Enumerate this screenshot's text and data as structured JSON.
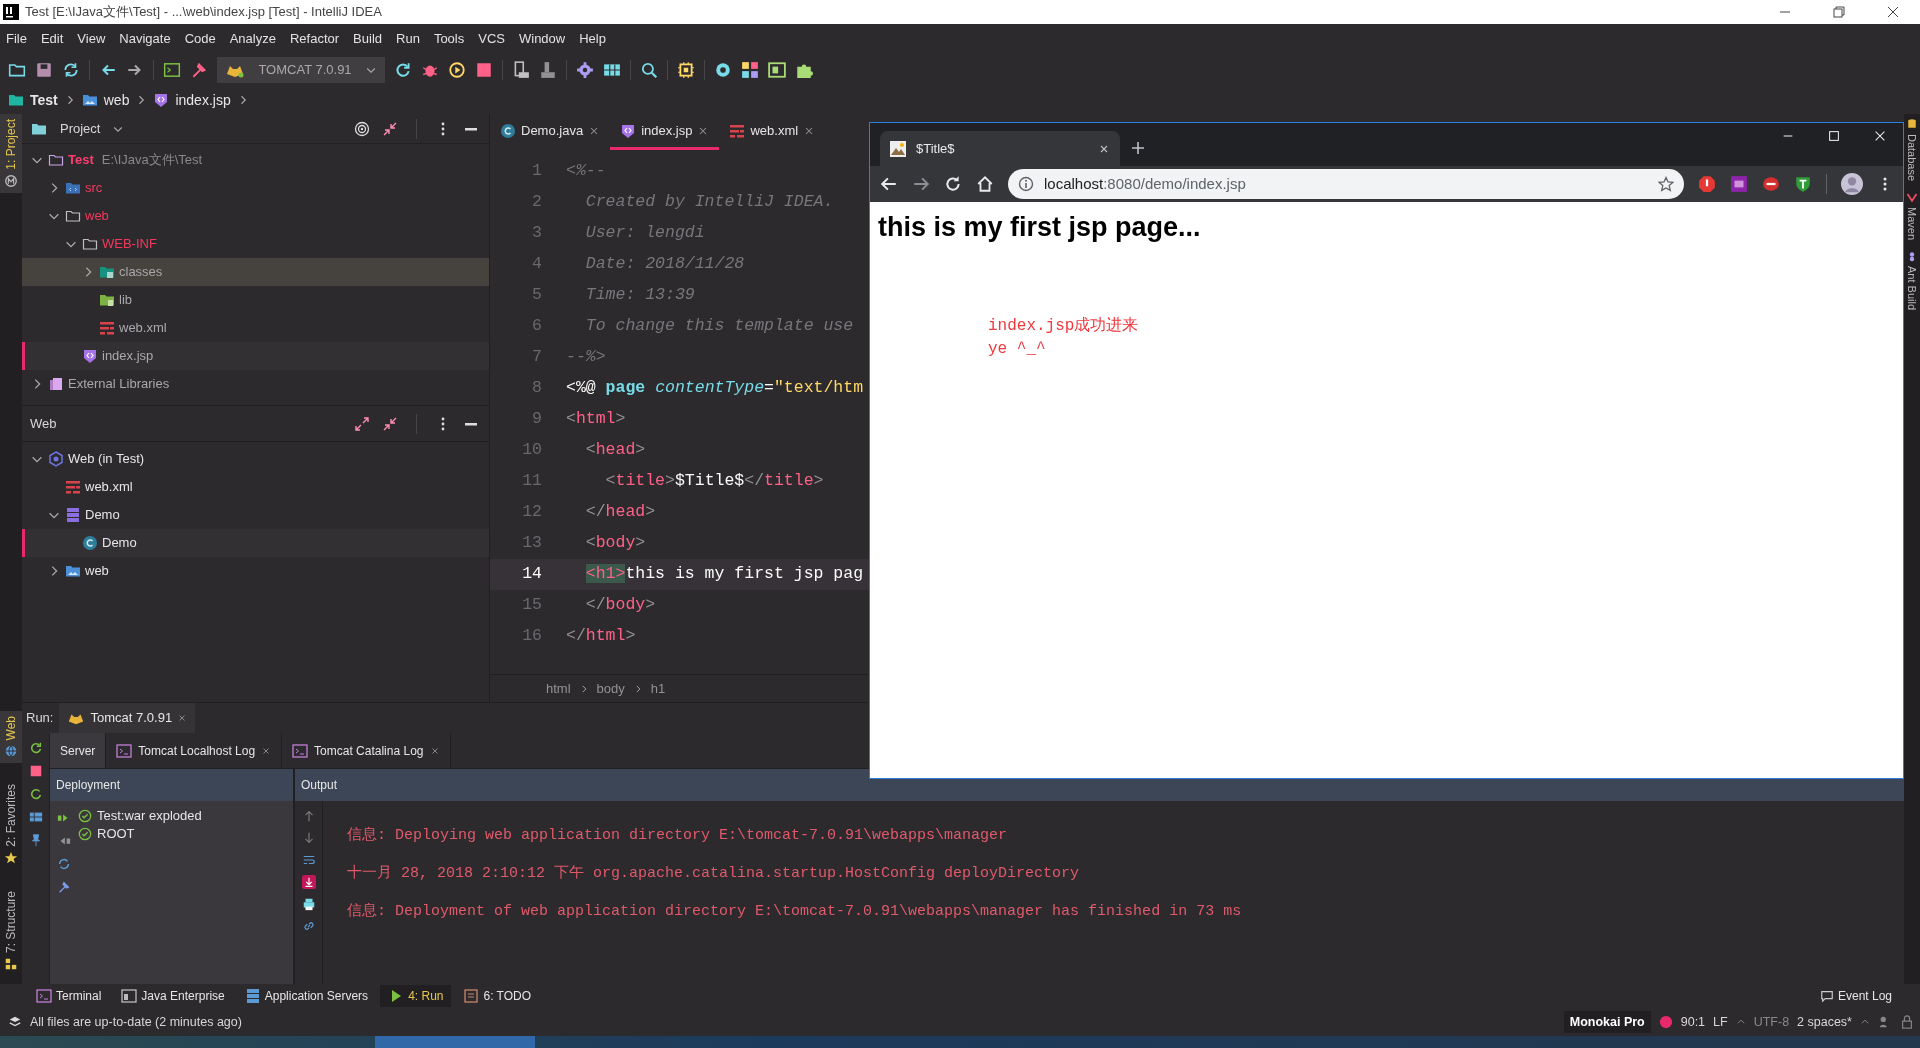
{
  "window": {
    "title": "Test [E:\\IJava文件\\Test] - ...\\web\\index.jsp [Test] - IntelliJ IDEA"
  },
  "menu": [
    "File",
    "Edit",
    "View",
    "Navigate",
    "Code",
    "Analyze",
    "Refactor",
    "Build",
    "Run",
    "Tools",
    "VCS",
    "Window",
    "Help"
  ],
  "toolbar": {
    "run_config": "TOMCAT 7.0.91"
  },
  "breadcrumb": [
    {
      "label": "Test",
      "kind": "project"
    },
    {
      "label": "web",
      "kind": "webroot"
    },
    {
      "label": "index.jsp",
      "kind": "jsp"
    }
  ],
  "left_stripe": {
    "top": [
      {
        "label": "1: Project",
        "kind": "project",
        "selected": true
      }
    ],
    "bottom": [
      {
        "label": "Web",
        "kind": "web",
        "selected": true
      },
      {
        "label": "2: Favorites",
        "kind": "favorites",
        "selected": false
      },
      {
        "label": "7: Structure",
        "kind": "structure",
        "selected": false
      }
    ]
  },
  "project_panel": {
    "title": "Project",
    "tree": [
      {
        "label": "Test",
        "path": "E:\\IJava文件\\Test",
        "kind": "module",
        "color": "#ff3d6e",
        "expanded": true,
        "selected": false,
        "current": false,
        "children": [
          {
            "label": "src",
            "kind": "src",
            "color": "#f23a5e",
            "expanded": false,
            "selected": false,
            "current": false
          },
          {
            "label": "web",
            "kind": "folder",
            "color": "#f23a5e",
            "expanded": true,
            "selected": false,
            "current": false,
            "children": [
              {
                "label": "WEB-INF",
                "kind": "folder",
                "color": "#f23a5e",
                "expanded": true,
                "selected": false,
                "current": false,
                "children": [
                  {
                    "label": "classes",
                    "kind": "classes",
                    "color": "#a9a8aa",
                    "expanded": false,
                    "selected": true,
                    "current": false
                  },
                  {
                    "label": "lib",
                    "kind": "lib",
                    "color": "#a9a8aa",
                    "selected": false,
                    "current": false
                  },
                  {
                    "label": "web.xml",
                    "kind": "xml",
                    "color": "#a9a8aa",
                    "selected": false,
                    "current": false
                  }
                ]
              },
              {
                "label": "index.jsp",
                "kind": "jsp",
                "color": "#a9a8aa",
                "selected": false,
                "current": true
              }
            ]
          }
        ]
      },
      {
        "label": "External Libraries",
        "kind": "libraries",
        "color": "#a9a8aa",
        "expanded": false,
        "selected": false,
        "current": false
      }
    ]
  },
  "web_panel": {
    "title": "Web",
    "tree": [
      {
        "label": "Web (in Test)",
        "kind": "facet",
        "color": "#e6e6e6",
        "expanded": true,
        "selected": false,
        "current": false,
        "children": [
          {
            "label": "web.xml",
            "kind": "xml",
            "color": "#e6e6e6",
            "selected": false,
            "current": false
          },
          {
            "label": "Demo",
            "kind": "artifact",
            "color": "#e6e6e6",
            "expanded": true,
            "selected": false,
            "current": false,
            "children": [
              {
                "label": "Demo",
                "kind": "class",
                "color": "#e6e6e6",
                "selected": false,
                "current": true
              }
            ]
          },
          {
            "label": "web",
            "kind": "webroot",
            "color": "#e6e6e6",
            "expanded": false,
            "selected": false,
            "current": false
          }
        ]
      }
    ]
  },
  "editor": {
    "tabs": [
      {
        "label": "Demo.java",
        "kind": "class",
        "selected": false
      },
      {
        "label": "index.jsp",
        "kind": "jsp",
        "selected": true
      },
      {
        "label": "web.xml",
        "kind": "xml",
        "selected": false
      }
    ],
    "lines": [
      {
        "n": "1",
        "current": false,
        "tokens": [
          {
            "kind": "comment",
            "t": "<%--"
          }
        ]
      },
      {
        "n": "2",
        "current": false,
        "tokens": [
          {
            "kind": "comment",
            "t": "  Created by IntelliJ IDEA."
          }
        ]
      },
      {
        "n": "3",
        "current": false,
        "tokens": [
          {
            "kind": "comment",
            "t": "  User: lengdi"
          }
        ]
      },
      {
        "n": "4",
        "current": false,
        "tokens": [
          {
            "kind": "comment",
            "t": "  Date: 2018/11/28"
          }
        ]
      },
      {
        "n": "5",
        "current": false,
        "tokens": [
          {
            "kind": "comment",
            "t": "  Time: 13:39"
          }
        ]
      },
      {
        "n": "6",
        "current": false,
        "tokens": [
          {
            "kind": "comment",
            "t": "  To change this template use"
          }
        ]
      },
      {
        "n": "7",
        "current": false,
        "tokens": [
          {
            "kind": "comment",
            "t": "--%>"
          }
        ]
      },
      {
        "n": "8",
        "current": false,
        "tokens": [
          {
            "kind": "plain",
            "t": "<%@ "
          },
          {
            "kind": "keyword",
            "t": "page "
          },
          {
            "kind": "attribute",
            "t": "contentType"
          },
          {
            "kind": "plain",
            "t": "="
          },
          {
            "kind": "string",
            "t": "\"text/htm"
          }
        ]
      },
      {
        "n": "9",
        "current": false,
        "tokens": [
          {
            "kind": "bracket",
            "t": "<"
          },
          {
            "kind": "tag",
            "t": "html"
          },
          {
            "kind": "bracket",
            "t": ">"
          }
        ]
      },
      {
        "n": "10",
        "current": false,
        "tokens": [
          {
            "kind": "bracket",
            "t": "  <"
          },
          {
            "kind": "tag",
            "t": "head"
          },
          {
            "kind": "bracket",
            "t": ">"
          }
        ]
      },
      {
        "n": "11",
        "current": false,
        "tokens": [
          {
            "kind": "bracket",
            "t": "    <"
          },
          {
            "kind": "tag",
            "t": "title"
          },
          {
            "kind": "bracket",
            "t": ">"
          },
          {
            "kind": "plain",
            "t": "$Title$"
          },
          {
            "kind": "bracket",
            "t": "</"
          },
          {
            "kind": "tag",
            "t": "title"
          },
          {
            "kind": "bracket",
            "t": ">"
          }
        ]
      },
      {
        "n": "12",
        "current": false,
        "tokens": [
          {
            "kind": "bracket",
            "t": "  </"
          },
          {
            "kind": "tag",
            "t": "head"
          },
          {
            "kind": "bracket",
            "t": ">"
          }
        ]
      },
      {
        "n": "13",
        "current": false,
        "tokens": [
          {
            "kind": "bracket",
            "t": "  <"
          },
          {
            "kind": "tag",
            "t": "body"
          },
          {
            "kind": "bracket",
            "t": ">"
          }
        ]
      },
      {
        "n": "14",
        "current": true,
        "tokens": [
          {
            "kind": "match",
            "t": "<h1>"
          },
          {
            "kind": "plain",
            "t": "this is my first jsp pag"
          }
        ]
      },
      {
        "n": "15",
        "current": false,
        "tokens": [
          {
            "kind": "bracket",
            "t": "  </"
          },
          {
            "kind": "tag",
            "t": "body"
          },
          {
            "kind": "bracket",
            "t": ">"
          }
        ]
      },
      {
        "n": "16",
        "current": false,
        "tokens": [
          {
            "kind": "bracket",
            "t": "</"
          },
          {
            "kind": "tag",
            "t": "html"
          },
          {
            "kind": "bracket",
            "t": ">"
          }
        ]
      }
    ],
    "crumbs": [
      "html",
      "body",
      "h1"
    ]
  },
  "run_panel": {
    "title": "Run:",
    "tab": "Tomcat 7.0.91",
    "subtabs": [
      {
        "label": "Server",
        "kind": "plain",
        "selected": true
      },
      {
        "label": "Tomcat Localhost Log",
        "kind": "log",
        "selected": false
      },
      {
        "label": "Tomcat Catalina Log",
        "kind": "log",
        "selected": false
      }
    ],
    "deployment": {
      "title": "Deployment",
      "items": [
        "Test:war exploded",
        "ROOT"
      ]
    },
    "output": {
      "title": "Output",
      "lines": [
        "信息: Deploying web application directory E:\\tomcat-7.0.91\\webapps\\manager",
        "十一月 28, 2018 2:10:12 下午 org.apache.catalina.startup.HostConfig deployDirectory",
        "信息: Deployment of web application directory E:\\tomcat-7.0.91\\webapps\\manager has finished in 73 ms"
      ]
    }
  },
  "right_stripe": [
    "Database",
    "Maven",
    "Ant Build"
  ],
  "tool_tabs": [
    {
      "label": "Terminal",
      "kind": "terminal",
      "selected": false
    },
    {
      "label": "Java Enterprise",
      "kind": "enterprise",
      "selected": false
    },
    {
      "label": "Application Servers",
      "kind": "servers",
      "selected": false
    },
    {
      "label": "4: Run",
      "kind": "run",
      "selected": true
    },
    {
      "label": "6: TODO",
      "kind": "todo",
      "selected": false
    }
  ],
  "event_log": "Event Log",
  "status_bar": {
    "message": "All files are up-to-date (2 minutes ago)",
    "theme": "Monokai Pro",
    "position": "90:1",
    "line_separator": "LF",
    "encoding": "UTF-8",
    "indent": "2 spaces*"
  },
  "browser": {
    "tab_title": "$Title$",
    "url_host": "localhost",
    "url_rest": ":8080/demo/index.jsp",
    "heading": "this is my first jsp page...",
    "lines": [
      "index.jsp成功进来",
      "ye ^_^"
    ]
  }
}
